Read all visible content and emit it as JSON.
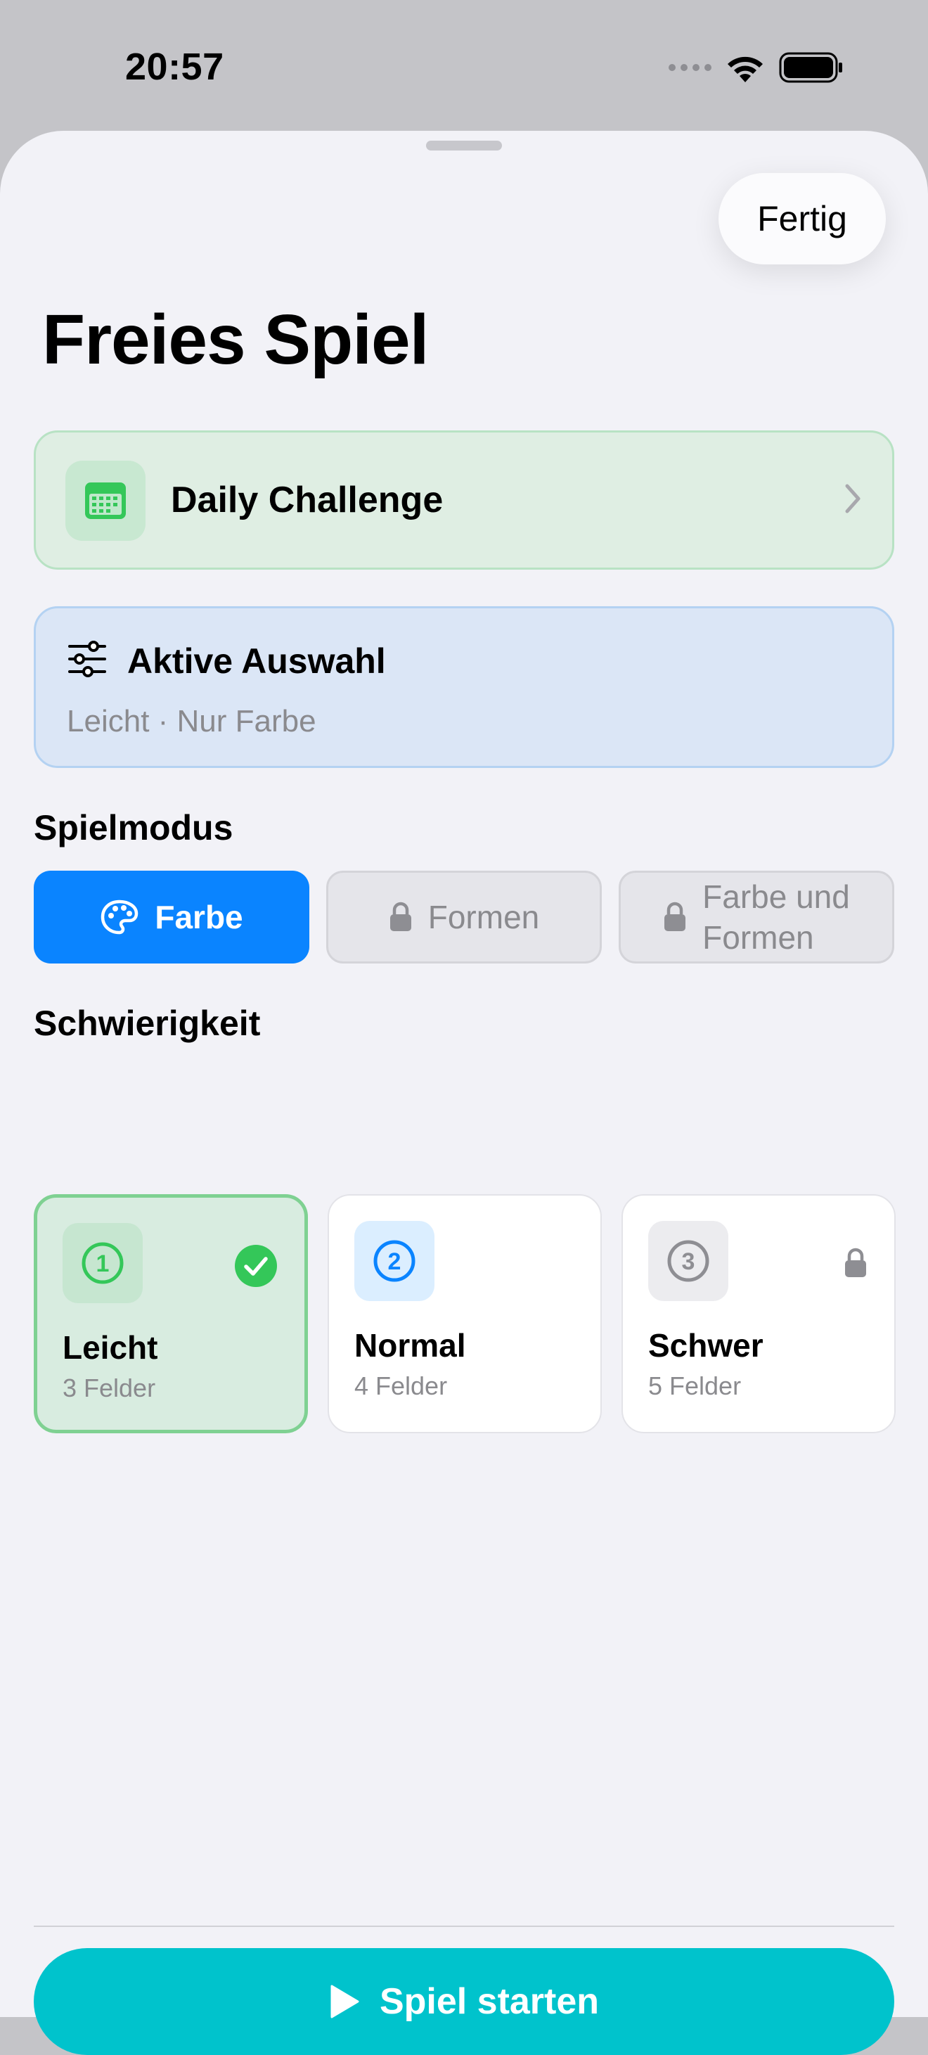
{
  "status_bar": {
    "time": "20:57"
  },
  "sheet": {
    "done_label": "Fertig",
    "title": "Freies Spiel",
    "daily_challenge": {
      "label": "Daily Challenge",
      "icon": "calendar-icon"
    },
    "active_selection": {
      "title": "Aktive Auswahl",
      "summary": "Leicht · Nur Farbe",
      "icon": "sliders-icon"
    },
    "game_mode": {
      "label": "Spielmodus",
      "options": [
        {
          "label": "Farbe",
          "state": "selected",
          "icon": "palette-icon"
        },
        {
          "label": "Formen",
          "state": "locked",
          "icon": "lock-icon"
        },
        {
          "label_line1": "Farbe und",
          "label_line2": "Formen",
          "state": "locked",
          "icon": "lock-icon"
        }
      ]
    },
    "difficulty": {
      "label": "Schwierigkeit",
      "options": [
        {
          "number": "1",
          "name": "Leicht",
          "fields": "3 Felder",
          "state": "selected"
        },
        {
          "number": "2",
          "name": "Normal",
          "fields": "4 Felder",
          "state": "available"
        },
        {
          "number": "3",
          "name": "Schwer",
          "fields": "5 Felder",
          "state": "locked"
        }
      ]
    },
    "start_label": "Spiel starten"
  },
  "colors": {
    "accent_blue": "#0a84ff",
    "success_green": "#34c759",
    "start_teal": "#00c3cc"
  }
}
